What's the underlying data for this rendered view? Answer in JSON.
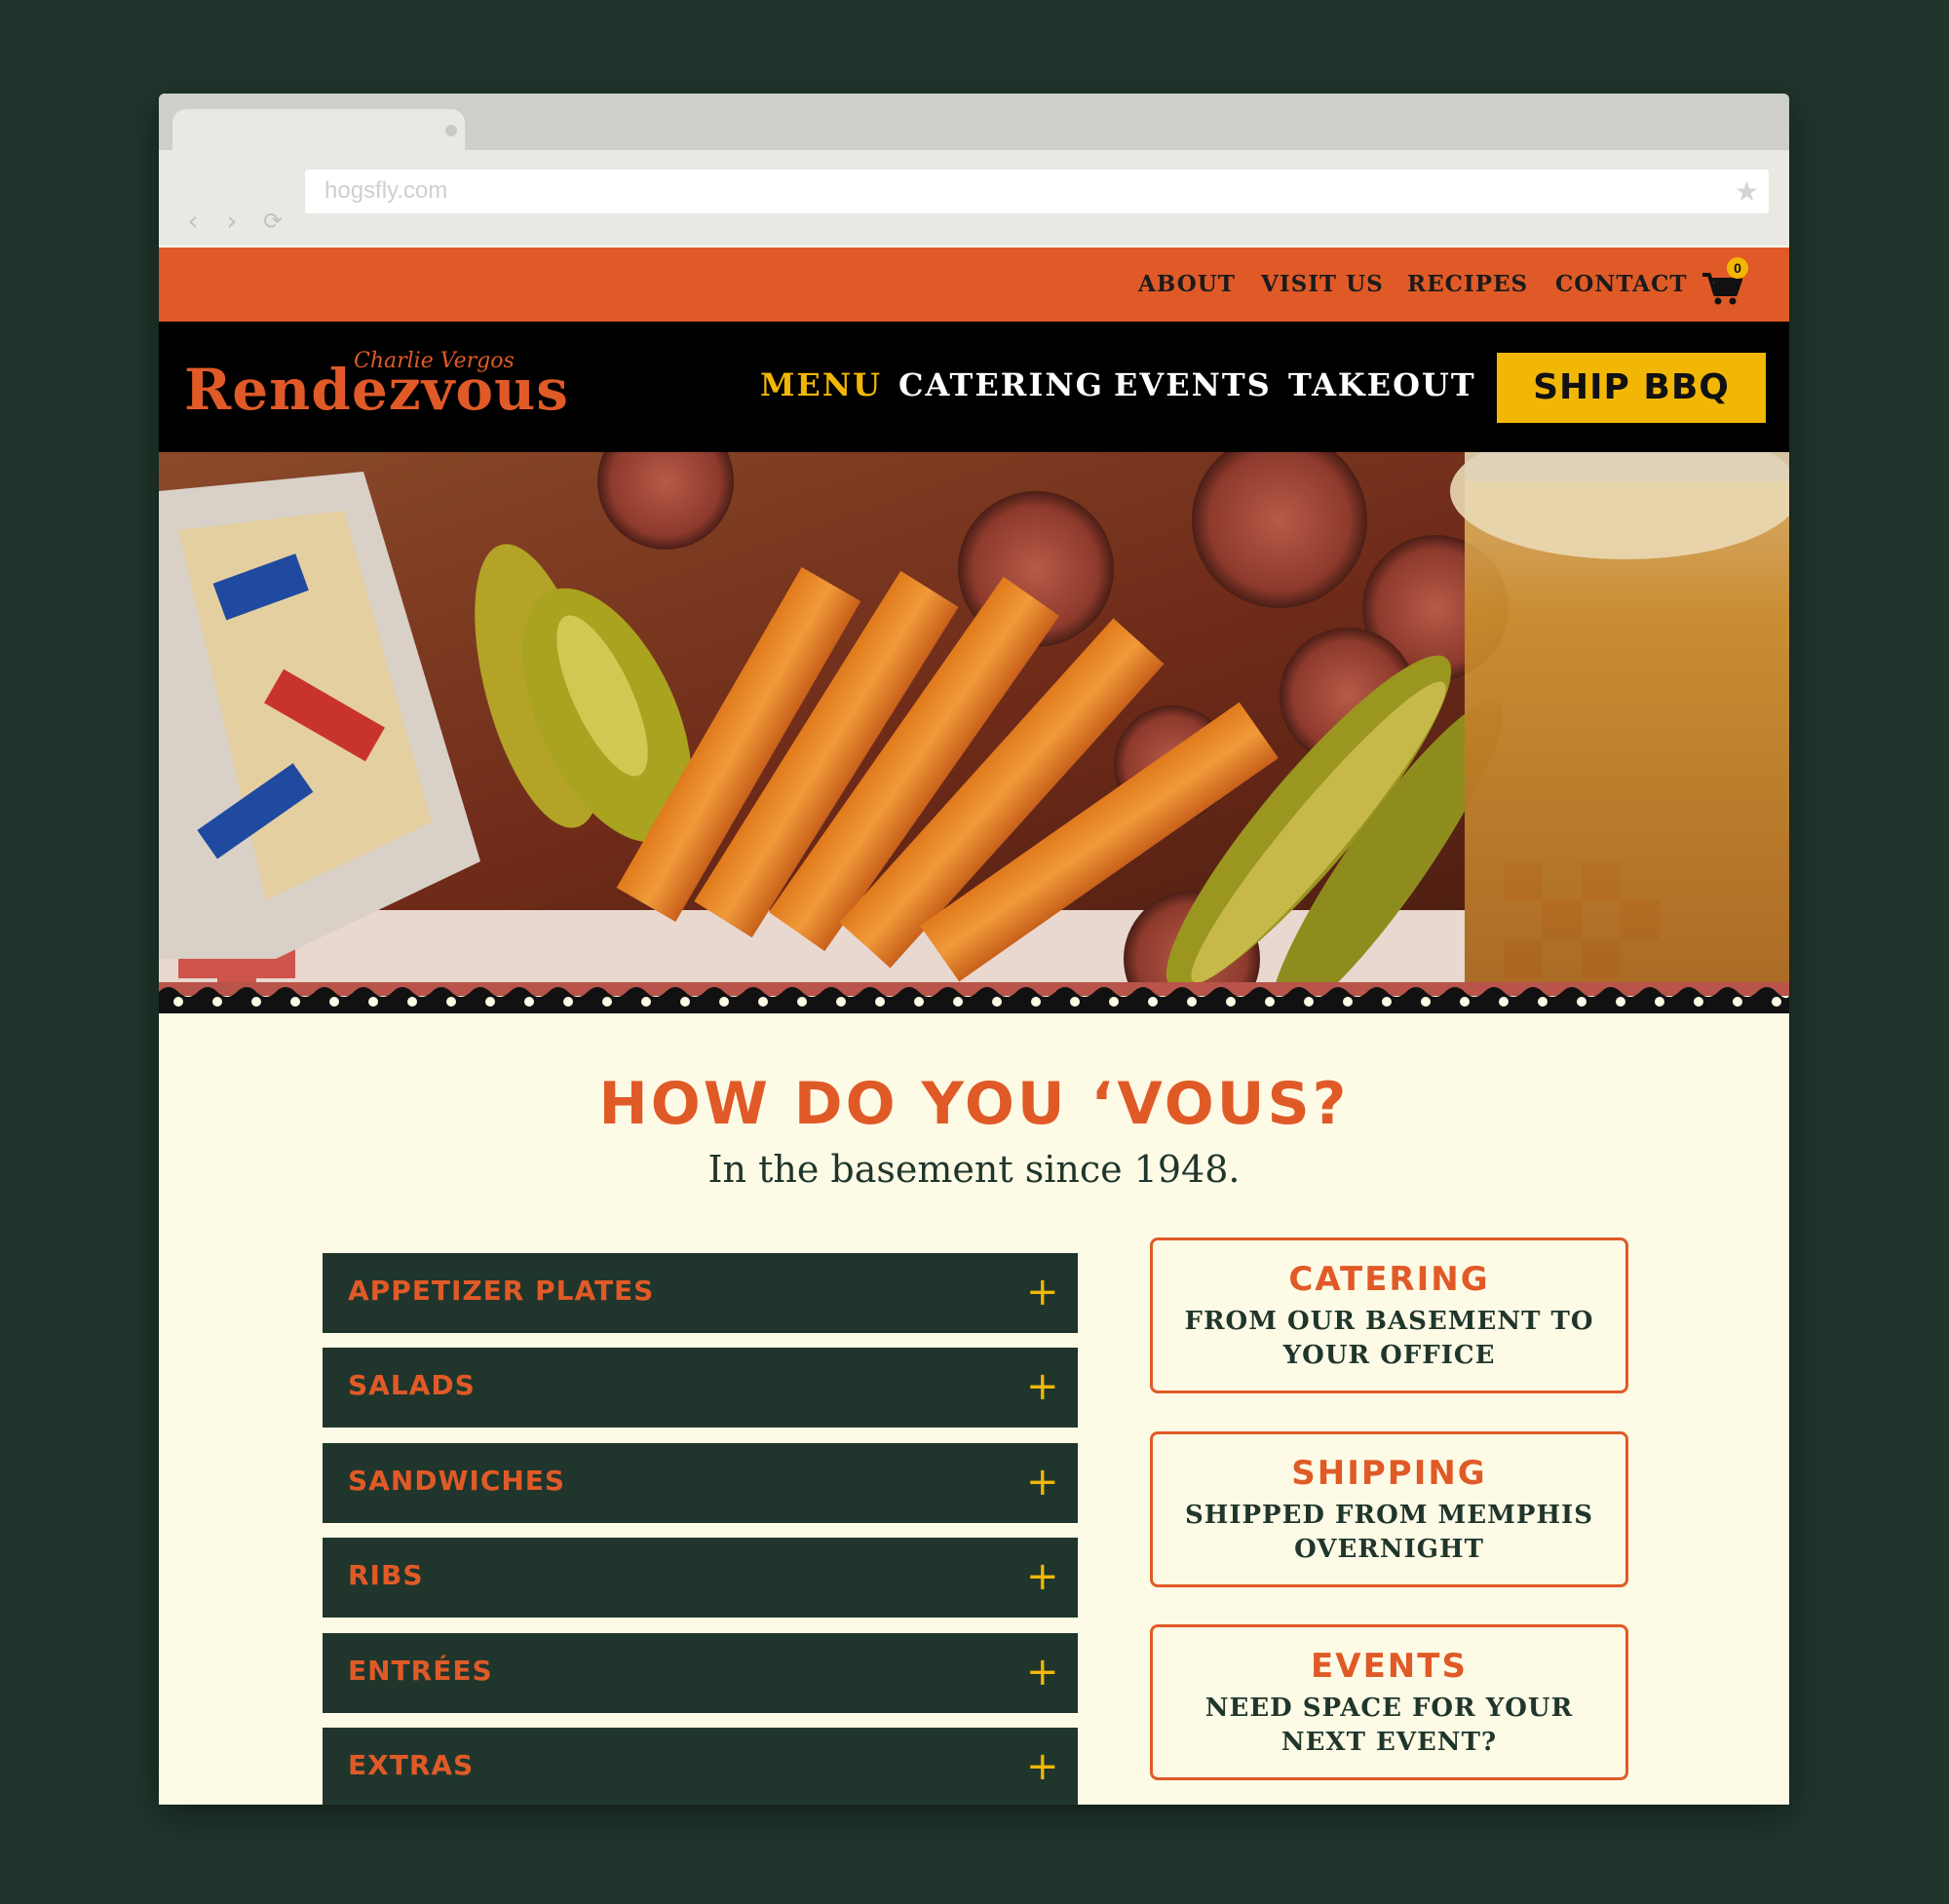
{
  "browser": {
    "url": "hogsfly.com",
    "back_icon": "chevron-left",
    "forward_icon": "chevron-right",
    "reload_icon": "reload",
    "star_icon": "star"
  },
  "utility_nav": {
    "items": [
      "ABOUT",
      "VISIT US",
      "RECIPES",
      "CONTACT"
    ],
    "cart_count": "0"
  },
  "logo": {
    "script": "Charlie Vergos",
    "name": "Rendezvous"
  },
  "main_nav": {
    "items": [
      "MENU",
      "CATERING",
      "EVENTS",
      "TAKEOUT"
    ],
    "active": "MENU",
    "cta": "SHIP BBQ"
  },
  "intro": {
    "headline": "HOW DO YOU ‘VOUS?",
    "subheadline": "In the basement since 1948."
  },
  "menu_categories": [
    {
      "label": "APPETIZER PLATES"
    },
    {
      "label": "SALADS"
    },
    {
      "label": "SANDWICHES"
    },
    {
      "label": "RIBS"
    },
    {
      "label": "ENTRÉES"
    },
    {
      "label": "EXTRAS"
    }
  ],
  "promo_cards": [
    {
      "title": "CATERING",
      "text": "FROM OUR BASEMENT TO YOUR OFFICE"
    },
    {
      "title": "SHIPPING",
      "text": "SHIPPED FROM MEMPHIS OVERNIGHT"
    },
    {
      "title": "EVENTS",
      "text": "NEED SPACE FOR YOUR NEXT EVENT?"
    }
  ],
  "colors": {
    "page_bg": "#20362c",
    "accent_orange": "#e05a27",
    "accent_yellow": "#f2b705",
    "cream": "#fdfbe6",
    "dark_green": "#20362c"
  }
}
